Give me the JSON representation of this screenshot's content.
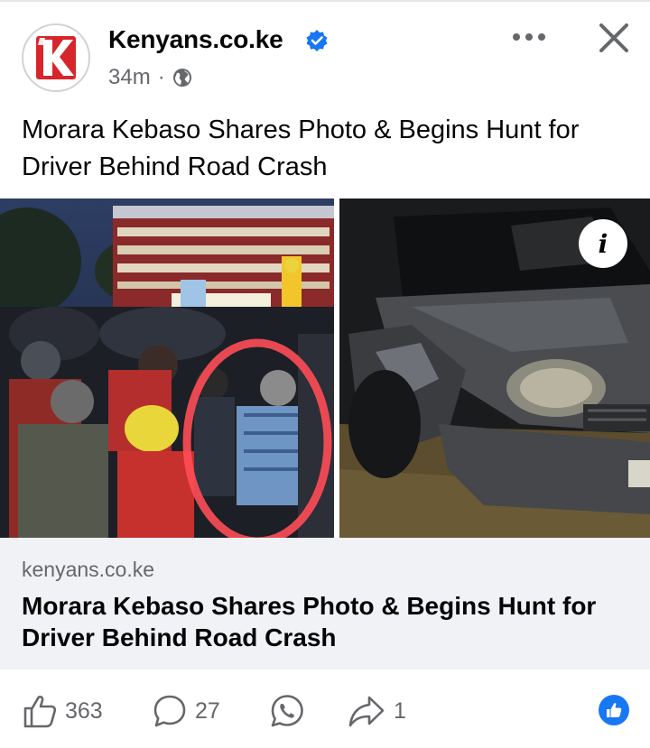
{
  "post": {
    "page_name": "Kenyans.co.ke",
    "time": "34m",
    "separator": "·",
    "text": "Morara Kebaso Shares Photo & Begins Hunt for Driver Behind Road Crash",
    "privacy_icon": "globe-icon"
  },
  "link_preview": {
    "domain": "kenyans.co.ke",
    "title": "Morara Kebaso Shares Photo & Begins Hunt for Driver Behind Road Crash"
  },
  "actions": {
    "likes": "363",
    "comments": "27",
    "shares": "1"
  },
  "colors": {
    "brand_red": "#d7262b",
    "accent_blue": "#1877f2",
    "muted_text": "#65676b",
    "card_bg": "#f0f2f5"
  }
}
